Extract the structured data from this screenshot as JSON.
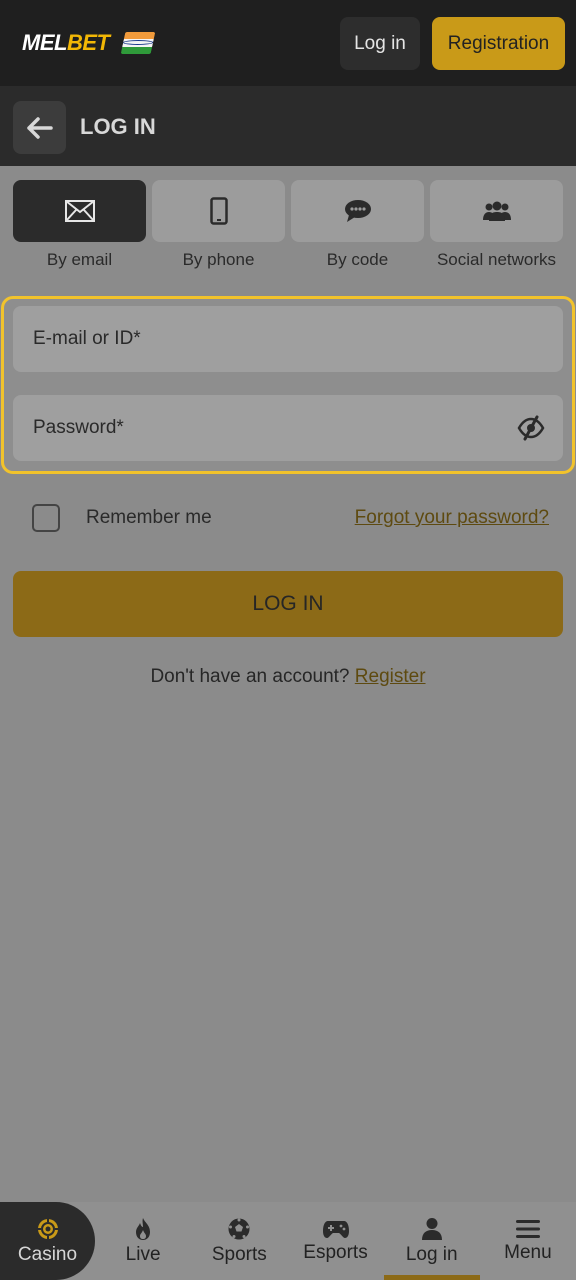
{
  "header": {
    "logo_main": "MEL",
    "logo_accent": "BET",
    "login_label": "Log in",
    "register_label": "Registration"
  },
  "titlebar": {
    "title": "LOG IN"
  },
  "tabs": [
    {
      "label": "By email",
      "icon": "envelope-icon",
      "active": true
    },
    {
      "label": "By phone",
      "icon": "phone-icon",
      "active": false
    },
    {
      "label": "By code",
      "icon": "chat-bubble-icon",
      "active": false
    },
    {
      "label": "Social networks",
      "icon": "users-icon",
      "active": false
    }
  ],
  "form": {
    "email_placeholder": "E-mail or ID*",
    "password_placeholder": "Password*"
  },
  "remember_label": "Remember me",
  "forgot_label": "Forgot your password?",
  "submit_label": "LOG IN",
  "signup": {
    "prompt": "Don't have an account?",
    "link": "Register"
  },
  "bottom_nav": [
    {
      "label": "Casino",
      "icon": "casino-chip-icon"
    },
    {
      "label": "Live",
      "icon": "flame-icon"
    },
    {
      "label": "Sports",
      "icon": "soccer-ball-icon"
    },
    {
      "label": "Esports",
      "icon": "gamepad-icon"
    },
    {
      "label": "Log in",
      "icon": "user-icon"
    },
    {
      "label": "Menu",
      "icon": "menu-icon"
    }
  ],
  "colors": {
    "accent": "#f2b705",
    "button_gold": "#c99a18",
    "dark": "#1f1f1f"
  }
}
